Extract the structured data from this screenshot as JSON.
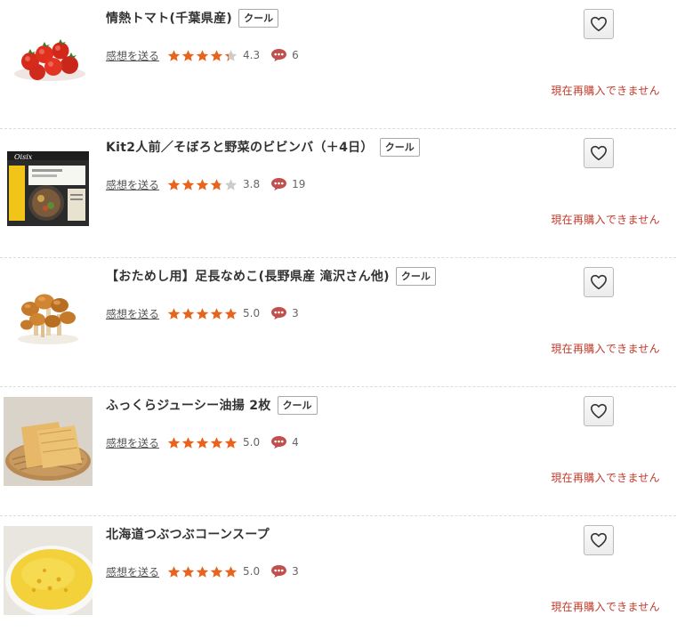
{
  "colors": {
    "star_filled": "#e8631c",
    "star_empty": "#cccccc",
    "status_text": "#c0392b",
    "comment_icon": "#c0504d"
  },
  "icons": {
    "favorite": "heart-outline-icon",
    "star": "star-icon",
    "comment": "comment-bubble-icon"
  },
  "items": [
    {
      "name": "情熱トマト(千葉県産)",
      "badge": "クール",
      "review_link": "感想を送る",
      "rating": "4.3",
      "rating_value": 4.3,
      "comments": "6",
      "status": "現在再購入できません",
      "image": "cherry-tomatoes"
    },
    {
      "name": "Kit2人前／そぼろと野菜のビビンバ（＋4日）",
      "badge": "クール",
      "review_link": "感想を送る",
      "rating": "3.8",
      "rating_value": 3.8,
      "comments": "19",
      "status": "現在再購入できません",
      "image": "meal-kit-bag",
      "image_brand": "Oisix"
    },
    {
      "name": "【おためし用】足長なめこ(長野県産 滝沢さん他)",
      "badge": "クール",
      "review_link": "感想を送る",
      "rating": "5.0",
      "rating_value": 5.0,
      "comments": "3",
      "status": "現在再購入できません",
      "image": "nameko-mushrooms"
    },
    {
      "name": "ふっくらジューシー油揚 2枚",
      "badge": "クール",
      "review_link": "感想を送る",
      "rating": "5.0",
      "rating_value": 5.0,
      "comments": "4",
      "status": "現在再購入できません",
      "image": "fried-tofu-on-basket"
    },
    {
      "name": "北海道つぶつぶコーンスープ",
      "badge": "",
      "review_link": "感想を送る",
      "rating": "5.0",
      "rating_value": 5.0,
      "comments": "3",
      "status": "現在再購入できません",
      "image": "corn-soup-bowl"
    }
  ]
}
